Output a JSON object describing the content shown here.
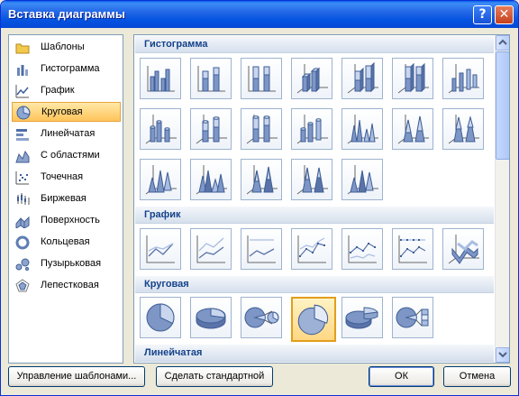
{
  "dialog": {
    "title": "Вставка диаграммы",
    "help_label": "?",
    "close_label": "✕"
  },
  "categories": [
    {
      "label": "Шаблоны",
      "icon": "folder-icon"
    },
    {
      "label": "Гистограмма",
      "icon": "column-chart-icon"
    },
    {
      "label": "График",
      "icon": "line-chart-icon"
    },
    {
      "label": "Круговая",
      "icon": "pie-chart-icon",
      "selected": true
    },
    {
      "label": "Линейчатая",
      "icon": "bar-chart-icon"
    },
    {
      "label": "С областями",
      "icon": "area-chart-icon"
    },
    {
      "label": "Точечная",
      "icon": "scatter-chart-icon"
    },
    {
      "label": "Биржевая",
      "icon": "stock-chart-icon"
    },
    {
      "label": "Поверхность",
      "icon": "surface-chart-icon"
    },
    {
      "label": "Кольцевая",
      "icon": "doughnut-chart-icon"
    },
    {
      "label": "Пузырьковая",
      "icon": "bubble-chart-icon"
    },
    {
      "label": "Лепестковая",
      "icon": "radar-chart-icon"
    }
  ],
  "sections": {
    "histogram": {
      "label": "Гистограмма"
    },
    "line": {
      "label": "График"
    },
    "pie": {
      "label": "Круговая"
    },
    "bar": {
      "label": "Линейчатая"
    }
  },
  "selected_subtype": "pie-3d",
  "buttons": {
    "manage_templates": "Управление шаблонами...",
    "set_default": "Сделать стандартной",
    "ok": "ОК",
    "cancel": "Отмена"
  },
  "colors": {
    "selection": "#FFC45A",
    "section_text": "#15428B"
  }
}
